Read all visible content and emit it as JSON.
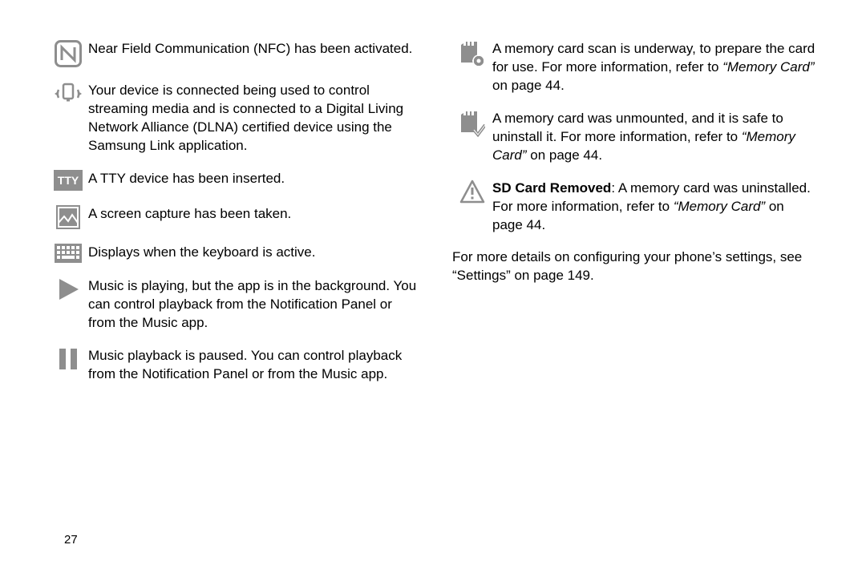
{
  "left": {
    "items": [
      {
        "text": "Near Field Communication (NFC) has been activated."
      },
      {
        "text": "Your device is connected being used to control streaming media and is connected to a Digital Living Network Alliance (DLNA) certified device using the Samsung Link application."
      },
      {
        "text": "A TTY device has been inserted."
      },
      {
        "text": "A screen capture has been taken."
      },
      {
        "text": "Displays when the keyboard is active."
      },
      {
        "text": "Music is playing, but the app is in the background. You can control playback from the Notification Panel or from the Music app."
      },
      {
        "text": "Music playback is paused. You can control playback from the Notification Panel or from the Music app."
      }
    ]
  },
  "right": {
    "items": [
      {
        "line1": "A memory card scan is underway, to prepare the card for use. For more information, refer to ",
        "ref": "“Memory Card”",
        "after": " on page 44."
      },
      {
        "line1": "A memory card was unmounted, and it is safe to uninstall it. For more information, refer to ",
        "ref": "“Memory Card”",
        "after": " on page 44."
      },
      {
        "bold": "SD Card Removed",
        "line1": ": A memory card was uninstalled. For more information, refer to ",
        "ref": "“Memory Card”",
        "after": " on page 44."
      }
    ],
    "footer_pre": "For more details on configuring your phone’s settings, see ",
    "footer_ref": "“Settings”",
    "footer_after": " on page 149."
  },
  "page_number": "27",
  "colors": {
    "icon_gray": "#8e8e8e"
  }
}
